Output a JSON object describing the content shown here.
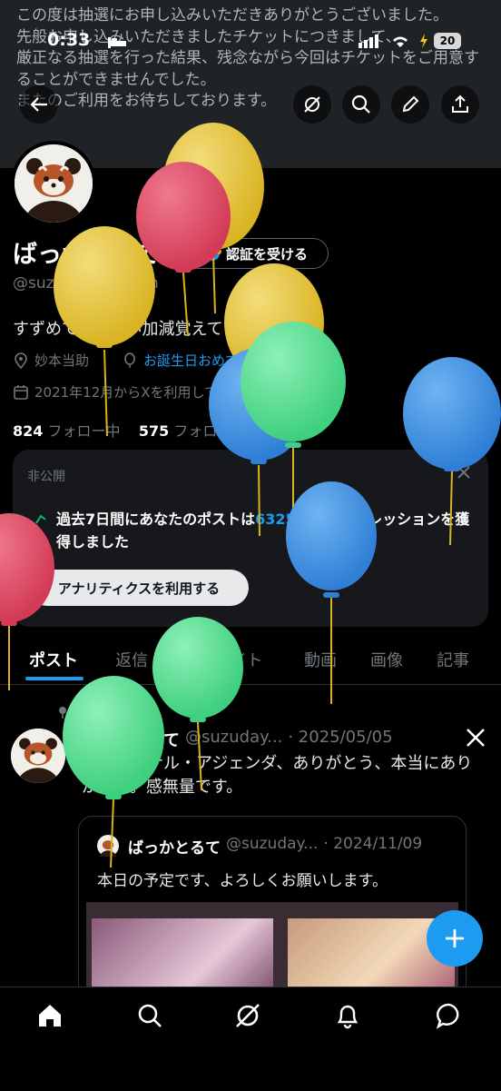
{
  "banner": {
    "text": "この度は抽選にお申し込みいただきありがとうございました。\n先般お申し込みいただきましたチケットにつきまして、\n厳正なる抽選を行った結果、残念ながら今回はチケットをご用意することができませんでした。\nまたのご利用をお待ちしております。"
  },
  "status_bar": {
    "time": "0:33",
    "battery": "20"
  },
  "profile": {
    "name": "ばっかとるて",
    "verify_label": "認証を受ける",
    "handle": "@suzudayoooooon",
    "bio": "すずめです、いい加減覚えてください。",
    "location": "妙本当助",
    "birthday": "お誕生日おめでとうございます。",
    "joined": "2021年12月からXを利用しています",
    "following_count": "824",
    "following_label": "フォロー中",
    "followers_count": "575",
    "followers_label": "フォロワー"
  },
  "analytics_card": {
    "label": "非公開",
    "text_part1": "過去7日間にあなたのポストは",
    "highlight": "6325件",
    "text_part2": "のインプレッションを獲得しました",
    "button": "アナリティクスを利用する"
  },
  "tabs": [
    "ポスト",
    "返信",
    "ハイライト",
    "動画",
    "画像",
    "記事"
  ],
  "pinned_post": {
    "pinned_label": "固定",
    "author": "ばっかとるて",
    "handle": "@suzuday...",
    "date": "· 2025/05/05",
    "text": "サブリミナル・アジェンダ、ありがとう、本当にありがとう。感無量です。",
    "quote": {
      "author": "ばっかとるて",
      "handle": "@suzuday...",
      "date": "· 2024/11/09",
      "text": "本日の予定です、よろしくお願いします。"
    }
  },
  "colors": {
    "accent": "#1d9bf0",
    "background": "#000000"
  },
  "icons": {
    "back": "back-arrow-icon",
    "grok": "grok-icon",
    "search": "search-icon",
    "edit": "edit-icon",
    "share": "share-icon",
    "home": "home-icon",
    "notifications": "bell-icon",
    "messages": "message-icon"
  }
}
